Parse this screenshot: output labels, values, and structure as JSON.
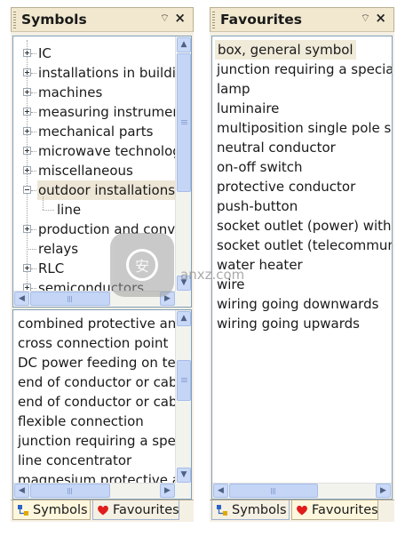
{
  "symbols_panel": {
    "title": "Symbols",
    "pin_glyph": "⌔",
    "close_glyph": "×",
    "tree": [
      {
        "label": "IC",
        "expander": "plus"
      },
      {
        "label": "installations in buildir",
        "expander": "plus"
      },
      {
        "label": "machines",
        "expander": "plus"
      },
      {
        "label": "measuring instrumen",
        "expander": "plus"
      },
      {
        "label": "mechanical parts",
        "expander": "plus"
      },
      {
        "label": "microwave technolog",
        "expander": "plus"
      },
      {
        "label": "miscellaneous",
        "expander": "plus"
      },
      {
        "label": "outdoor installations",
        "expander": "minus",
        "selected": true
      },
      {
        "label": "line",
        "expander": "none",
        "child": true
      },
      {
        "label": "production and conve",
        "expander": "plus"
      },
      {
        "label": "relays",
        "expander": "none"
      },
      {
        "label": "RLC",
        "expander": "plus"
      },
      {
        "label": "semiconductors",
        "expander": "plus",
        "clipped": true
      }
    ],
    "list": [
      "combined protective and",
      "cross connection point",
      "DC power feeding on te",
      "end of conductor or cab",
      "end of conductor or cab",
      "flexible connection",
      "junction requiring a spe",
      "line concentrator",
      "magnesium protective a"
    ],
    "tabs": [
      {
        "label": "Symbols",
        "icon": "symbols-icon",
        "active": true
      },
      {
        "label": "Favourites",
        "icon": "heart-icon",
        "active": false
      }
    ]
  },
  "favourites_panel": {
    "title": "Favourites",
    "pin_glyph": "⌔",
    "close_glyph": "×",
    "items": [
      {
        "label": "box, general symbol",
        "selected": true
      },
      {
        "label": "junction requiring a special"
      },
      {
        "label": "lamp"
      },
      {
        "label": "luminaire"
      },
      {
        "label": "multiposition single pole sw"
      },
      {
        "label": "neutral conductor"
      },
      {
        "label": "on-off switch"
      },
      {
        "label": "protective conductor"
      },
      {
        "label": "push-button"
      },
      {
        "label": "socket outlet (power) with p"
      },
      {
        "label": "socket outlet (telecommunic"
      },
      {
        "label": "water heater"
      },
      {
        "label": "wire"
      },
      {
        "label": "wiring going downwards"
      },
      {
        "label": "wiring going upwards"
      }
    ],
    "tabs": [
      {
        "label": "Symbols",
        "icon": "symbols-icon",
        "active": false
      },
      {
        "label": "Favourites",
        "icon": "heart-icon",
        "active": true
      }
    ]
  },
  "scroll_glyphs": {
    "up": "▲",
    "down": "▼",
    "left": "◀",
    "right": "▶"
  },
  "watermark": {
    "text": "anxz.com",
    "logo_text": "安"
  },
  "colors": {
    "accent": "#c4d5f6",
    "panel_bg": "#f5f0e4",
    "selection": "#ede6d6",
    "border": "#7f9db9"
  }
}
